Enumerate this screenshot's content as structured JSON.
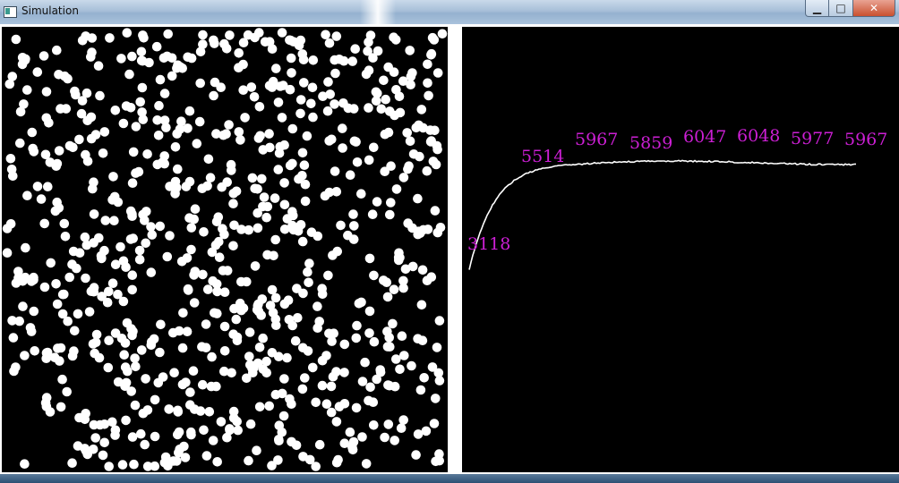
{
  "window": {
    "title": "Simulation",
    "buttons": {
      "minimize": "▁",
      "maximize": "□",
      "close": "✕"
    }
  },
  "colors": {
    "particle": "#ffffff",
    "background": "#000000",
    "label": "#cc1fd4",
    "curve": "#ffffff"
  },
  "simulation": {
    "particle_shape": "circle",
    "particle_count_estimate": 800
  },
  "chart_data": {
    "type": "line",
    "series": [
      {
        "values": [
          3118,
          5514,
          5967,
          5859,
          6047,
          6048,
          5977,
          5967
        ]
      }
    ],
    "data_labels": [
      "3118",
      "5514",
      "5967",
      "5859",
      "6047",
      "6048",
      "5977",
      "5967"
    ],
    "grid": false,
    "axes_visible": false
  }
}
